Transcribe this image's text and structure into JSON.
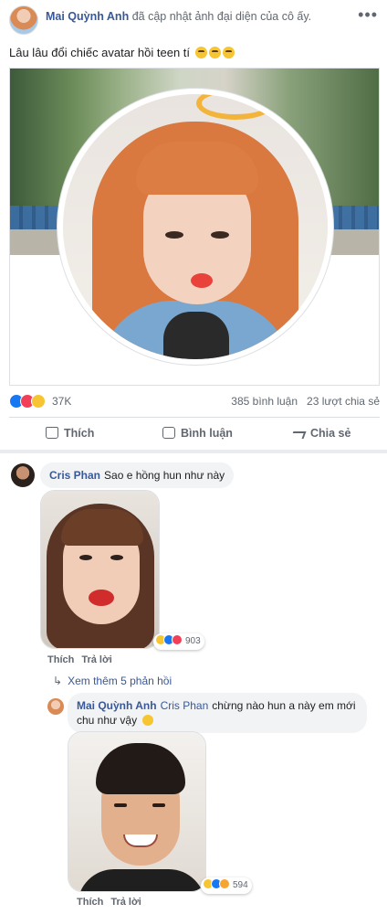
{
  "post": {
    "author": "Mai Quỳnh Anh",
    "action_text": "đã cập nhật ảnh đại diện của cô ấy.",
    "more_label": "•••",
    "caption": "Lâu lâu đổi chiếc avatar hồi teen tí",
    "caption_emoji": [
      "crying-face",
      "crying-face",
      "crying-face"
    ]
  },
  "reactions": {
    "icons": [
      "like",
      "love",
      "haha"
    ],
    "count": "37K",
    "comments": "385 bình luận",
    "shares": "23 lượt chia sẻ"
  },
  "actions": {
    "like": "Thích",
    "comment": "Bình luận",
    "share": "Chia sẻ"
  },
  "comments": [
    {
      "name": "Cris Phan",
      "text": "Sao e hồng hun như này",
      "reaction_count": "903",
      "reaction_icons": [
        "haha",
        "like",
        "love"
      ],
      "like_label": "Thích",
      "reply_label": "Trả lời"
    }
  ],
  "view_more": "Xem thêm 5 phản hồi",
  "reply": {
    "name": "Mai Quỳnh Anh",
    "mention": "Cris Phan",
    "text": "chừng nào hun a này em mới chu như vậy",
    "reaction_count": "594",
    "reaction_icons": [
      "haha",
      "like",
      "wow"
    ],
    "like_label": "Thích",
    "reply_label": "Trả lời"
  },
  "colors": {
    "link": "#385898",
    "like": "#1877f2",
    "love": "#f33e58",
    "haha": "#f7c531",
    "bubble": "#f2f3f5"
  }
}
